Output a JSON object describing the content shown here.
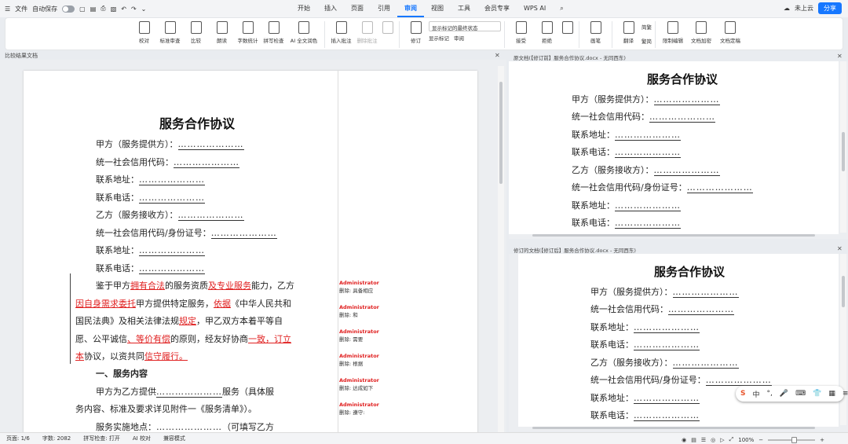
{
  "topbar": {
    "menu_label": "文件",
    "autosave_label": "自动保存",
    "tabs": [
      "开始",
      "插入",
      "页面",
      "引用",
      "审阅",
      "视图",
      "工具",
      "会员专享",
      "WPS AI"
    ],
    "active_tab": "审阅",
    "cloud_label": "未上云",
    "share_label": "分享"
  },
  "ribbon": {
    "group1": [
      "校对",
      "标准审查",
      "比较",
      "朗读",
      "字数统计",
      "拼写检查",
      "AI 全文润色"
    ],
    "group2": [
      "插入批注",
      "删除批注"
    ],
    "revision_label": "修订",
    "display_dropdown": "显示标记的最终状态",
    "display_markup": "显示标记",
    "review_label": "审阅",
    "group3": [
      "接受",
      "拒绝"
    ],
    "pen_label": "画笔",
    "translate_label": "翻译",
    "simp_trad_top": "简繁",
    "simp_trad_bottom": "繁简",
    "group4": [
      "限制编辑",
      "文档加密",
      "文档定稿"
    ]
  },
  "left_pane": {
    "header": "比较结果文档",
    "title": "服务合作协议",
    "lines": {
      "party_a": "甲方（服务提供方）：",
      "credit_code": "统一社会信用代码：",
      "address": "联系地址：",
      "phone": "联系电话：",
      "party_b": "乙方（服务接收方）：",
      "credit_id": "统一社会信用代码/身份证号：",
      "address2": "联系地址：",
      "phone2": "联系电话："
    },
    "dots": "…………………",
    "para": {
      "p1a": "鉴于甲方",
      "p1r1": "拥有合法",
      "p1b": "的服务资质",
      "p1r2": "及专业服务",
      "p1c": "能力，乙方",
      "p2r1": "因自身需求委托",
      "p2a": "甲方提供特定服务，",
      "p2r2": "依据",
      "p2b": "《中华人民共和",
      "p3a": "国民法典》及相关法律法规",
      "p3r1": "规定",
      "p3b": "，甲乙双方本着平等自",
      "p4a": "愿、公平诚信",
      "p4r1": "、等价有偿",
      "p4b": "的原则，经友好协商",
      "p4r2": "一致，订立",
      "p5r1": "本",
      "p5a": "协议，以资共同",
      "p5r2": "信守履行。"
    },
    "section1": "一、服务内容",
    "s1p1": "甲方为乙方提供",
    "s1p1b": "服务（具体服",
    "s1p2": "务内容、标准及要求详见附件一《服务清单》）。",
    "s1p3": "服务实施地点：",
    "s1p3b": "（可填写乙方",
    "comments": [
      {
        "author": "Administrator",
        "action": "删除: 具备相应"
      },
      {
        "author": "Administrator",
        "action": "删除: 和"
      },
      {
        "author": "Administrator",
        "action": "删除: 需要"
      },
      {
        "author": "Administrator",
        "action": "删除: 根据"
      },
      {
        "author": "Administrator",
        "action": "删除: 达成如下"
      },
      {
        "author": "Administrator",
        "action": "删除: 遵守:"
      }
    ]
  },
  "right_top": {
    "header": "原文档(【修订前】服务合作协议.docx - 无同西东)",
    "title": "服务合作协议",
    "lines": [
      "甲方（服务提供方）：",
      "统一社会信用代码：",
      "联系地址：",
      "联系电话：",
      "乙方（服务接收方）：",
      "统一社会信用代码/身份证号：",
      "联系地址：",
      "联系电话："
    ]
  },
  "right_bottom": {
    "header": "修订的文档(【修订后】服务合作协议.docx - 无同西东)",
    "title": "服务合作协议",
    "lines": [
      "甲方（服务提供方）：",
      "统一社会信用代码：",
      "联系地址：",
      "联系电话：",
      "乙方（服务接收方）：",
      "统一社会信用代码/身份证号：",
      "联系地址：",
      "联系电话："
    ]
  },
  "ime": {
    "items": [
      "S",
      "中",
      "°,",
      "🎤",
      "⌨",
      "👕",
      "▦",
      "≡"
    ]
  },
  "status": {
    "page": "页面: 1/6",
    "words": "字数: 2082",
    "spell": "拼写检查: 打开",
    "ai": "AI 校对",
    "compat": "兼容模式",
    "zoom": "100%"
  },
  "colors": {
    "accent": "#1677ff",
    "revision_red": "#e02020"
  }
}
